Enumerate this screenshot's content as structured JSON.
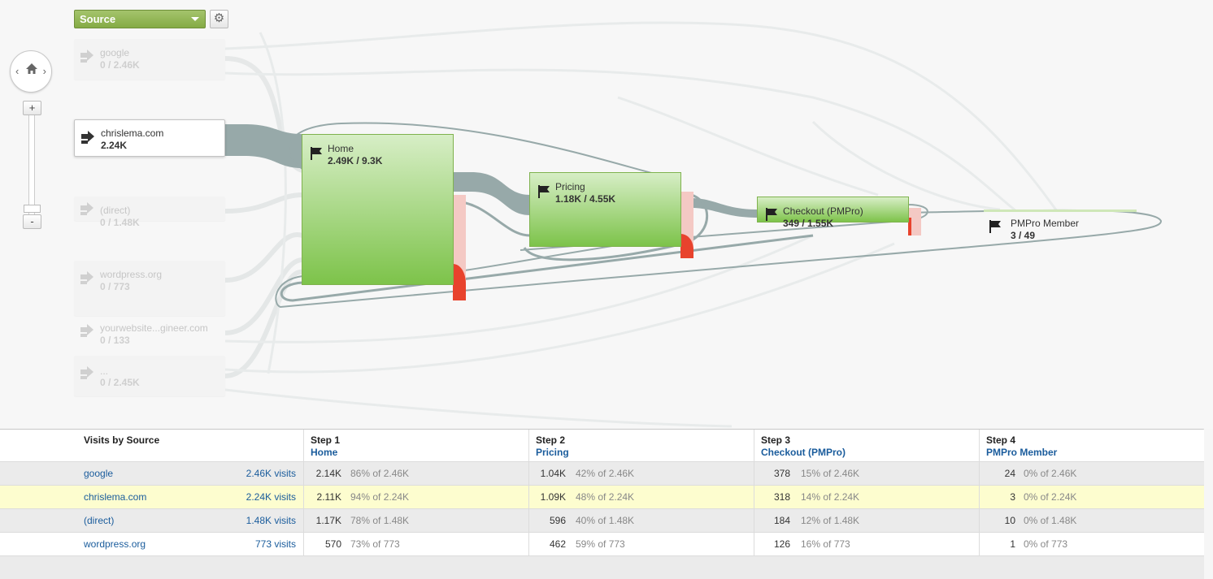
{
  "dimension": {
    "label": "Source"
  },
  "sources": [
    {
      "name": "google",
      "count": "0 / 2.46K"
    },
    {
      "name": "chrislema.com",
      "count": "2.24K"
    },
    {
      "name": "(direct)",
      "count": "0 / 1.48K"
    },
    {
      "name": "wordpress.org",
      "count": "0 / 773"
    },
    {
      "name": "yourwebsite...gineer.com",
      "count": "0 / 133"
    },
    {
      "name": "...",
      "count": "0 / 2.45K"
    }
  ],
  "steps": [
    {
      "name": "Home",
      "count": "2.49K / 9.3K"
    },
    {
      "name": "Pricing",
      "count": "1.18K / 4.55K"
    },
    {
      "name": "Checkout (PMPro)",
      "count": "349 / 1.55K"
    },
    {
      "name": "PMPro Member",
      "count": "3 / 49"
    }
  ],
  "table": {
    "source_header": "Visits by Source",
    "step_headers": [
      {
        "step": "Step 1",
        "name": "Home"
      },
      {
        "step": "Step 2",
        "name": "Pricing"
      },
      {
        "step": "Step 3",
        "name": "Checkout (PMPro)"
      },
      {
        "step": "Step 4",
        "name": "PMPro Member"
      }
    ],
    "rows": [
      {
        "source": "google",
        "visits": "2.46K visits",
        "cells": [
          {
            "n": "2.14K",
            "p": "86% of 2.46K"
          },
          {
            "n": "1.04K",
            "p": "42% of 2.46K"
          },
          {
            "n": "378",
            "p": "15% of 2.46K"
          },
          {
            "n": "24",
            "p": "0% of 2.46K"
          }
        ]
      },
      {
        "source": "chrislema.com",
        "visits": "2.24K visits",
        "cells": [
          {
            "n": "2.11K",
            "p": "94% of 2.24K"
          },
          {
            "n": "1.09K",
            "p": "48% of 2.24K"
          },
          {
            "n": "318",
            "p": "14% of 2.24K"
          },
          {
            "n": "3",
            "p": "0% of 2.24K"
          }
        ]
      },
      {
        "source": "(direct)",
        "visits": "1.48K visits",
        "cells": [
          {
            "n": "1.17K",
            "p": "78% of 1.48K"
          },
          {
            "n": "596",
            "p": "40% of 1.48K"
          },
          {
            "n": "184",
            "p": "12% of 1.48K"
          },
          {
            "n": "10",
            "p": "0% of 1.48K"
          }
        ]
      },
      {
        "source": "wordpress.org",
        "visits": "773 visits",
        "cells": [
          {
            "n": "570",
            "p": "73% of 773"
          },
          {
            "n": "462",
            "p": "59% of 773"
          },
          {
            "n": "126",
            "p": "16% of 773"
          },
          {
            "n": "1",
            "p": "0% of 773"
          }
        ]
      }
    ]
  },
  "colors": {
    "accent_green": "#85ab45",
    "link_blue": "#1a5c9c",
    "drop_red": "#e8432d",
    "highlight_row": "#fdfdcf"
  },
  "icons": {
    "dimension_menu": "chevron-down-icon",
    "settings": "gear-icon",
    "home": "home-icon",
    "source_entry": "arrow-right-icon",
    "step": "flag-icon"
  }
}
